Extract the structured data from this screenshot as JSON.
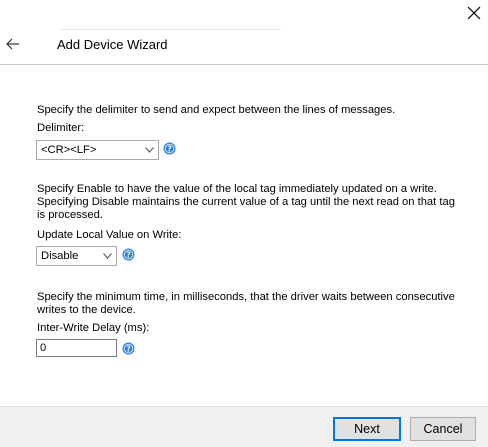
{
  "window": {
    "title": "Add Device Wizard"
  },
  "icons": {
    "close": "close-icon",
    "back": "back-arrow-icon",
    "help": "help-icon",
    "dropdown": "chevron-down-icon"
  },
  "sections": {
    "delimiter": {
      "description": "Specify the delimiter to send and expect between the lines of messages.",
      "label": "Delimiter:",
      "value": "<CR><LF>"
    },
    "update_local": {
      "description": "Specify Enable to have the value of the local tag immediately updated on a write. Specifying Disable maintains the current value of a tag until the next read on that tag is processed.",
      "label": "Update Local Value on Write:",
      "value": "Disable"
    },
    "inter_write": {
      "description": "Specify the minimum time, in milliseconds, that the driver waits between consecutive writes to the device.",
      "label": "Inter-Write Delay (ms):",
      "value": "0"
    }
  },
  "footer": {
    "next_label": "Next",
    "cancel_label": "Cancel"
  },
  "colors": {
    "accent": "#0078d7",
    "help_blue": "#2f7fd8",
    "footer_bg": "#f0f0f0"
  }
}
